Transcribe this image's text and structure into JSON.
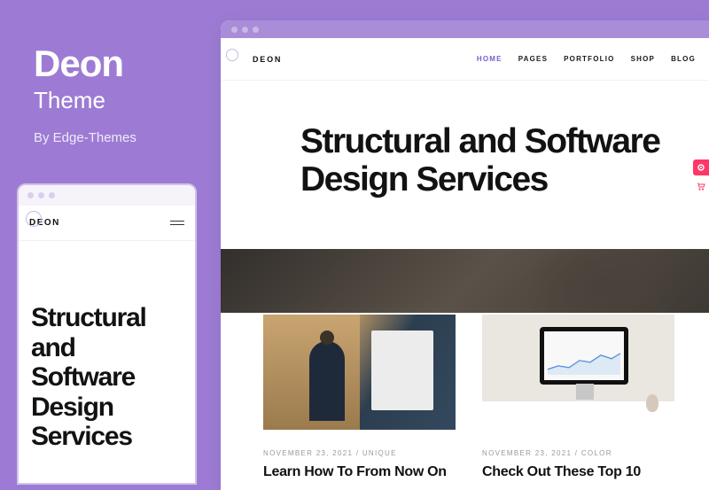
{
  "theme": {
    "name": "Deon",
    "label": "Theme",
    "author": "By Edge-Themes"
  },
  "mobile": {
    "logo": "DEON",
    "hero": "Structural and Software Design Services"
  },
  "desktop": {
    "logo": "DEON",
    "nav": {
      "home": "HOME",
      "pages": "PAGES",
      "portfolio": "PORTFOLIO",
      "shop": "SHOP",
      "blog": "BLOG"
    },
    "hero": "Structural and Software Design Services",
    "cards": [
      {
        "date": "NOVEMBER 23, 2021",
        "category": "UNIQUE",
        "title": "Learn How To From Now On"
      },
      {
        "date": "NOVEMBER 23, 2021",
        "category": "COLOR",
        "title": "Check Out These Top 10"
      }
    ]
  }
}
